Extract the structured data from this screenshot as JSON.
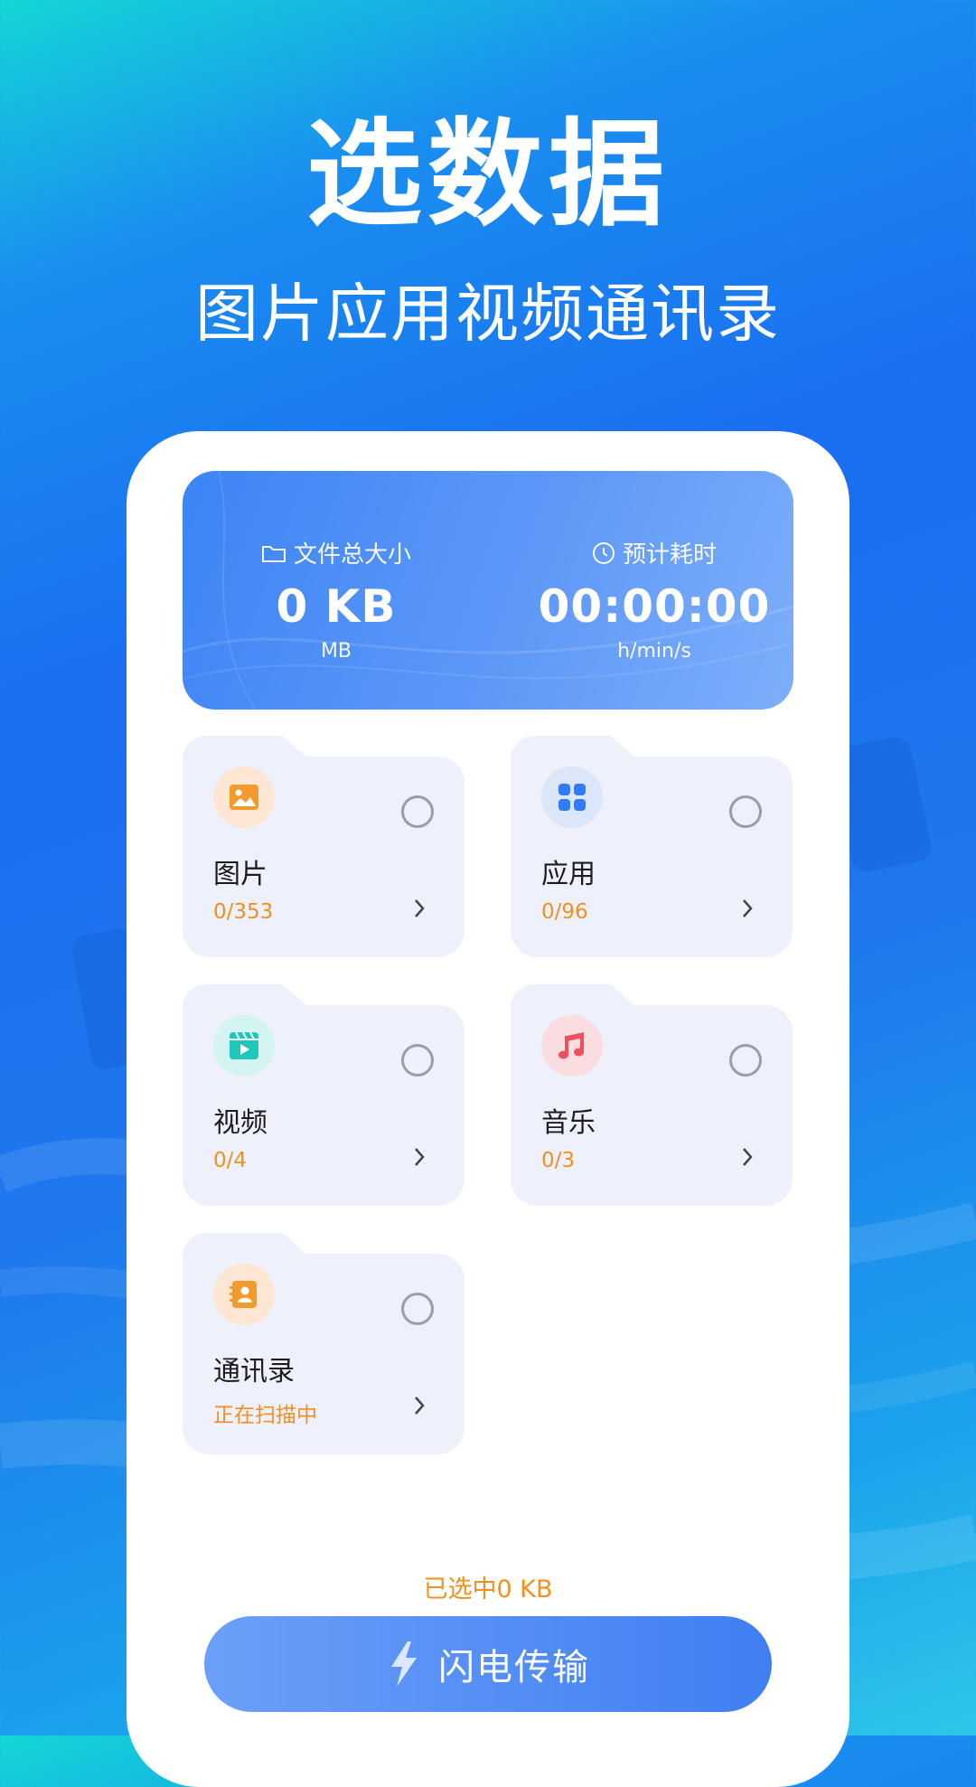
{
  "hero": {
    "title": "选数据",
    "subtitle": "图片应用视频通讯录"
  },
  "stats": {
    "size_label": "文件总大小",
    "size_value": "0 KB",
    "size_unit": "MB",
    "time_label": "预计耗时",
    "time_value": "00:00:00",
    "time_unit": "h/min/s"
  },
  "categories": [
    {
      "name": "图片",
      "count": "0/353",
      "icon": "image-icon",
      "color": "#f39a2c"
    },
    {
      "name": "应用",
      "count": "0/96",
      "icon": "apps-icon",
      "color": "#2f7cf6"
    },
    {
      "name": "视频",
      "count": "0/4",
      "icon": "video-icon",
      "color": "#1fc7bb"
    },
    {
      "name": "音乐",
      "count": "0/3",
      "icon": "music-icon",
      "color": "#f0505c"
    },
    {
      "name": "通讯录",
      "count": "正在扫描中",
      "icon": "contacts-icon",
      "color": "#f39a2c"
    }
  ],
  "footer": {
    "selected_text": "已选中0 KB",
    "send_label": "闪电传输"
  }
}
